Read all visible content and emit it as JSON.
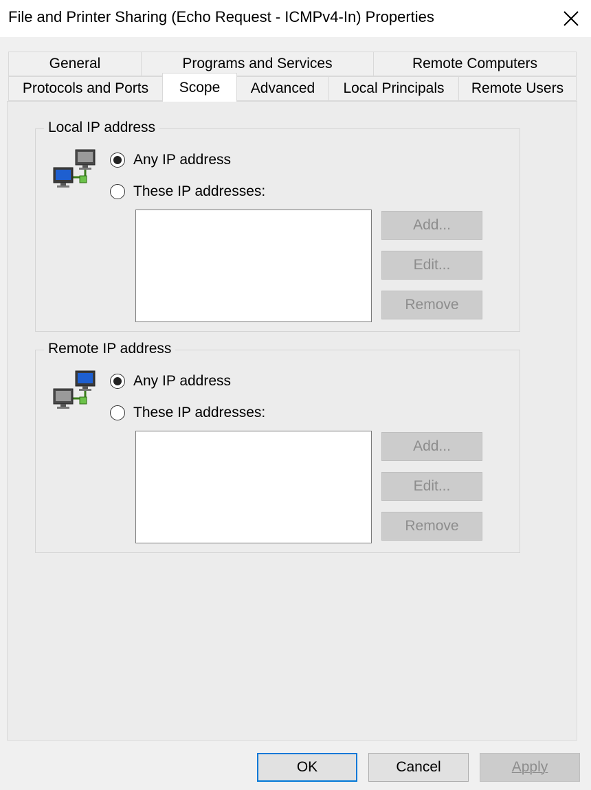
{
  "window": {
    "title": "File and Printer Sharing (Echo Request - ICMPv4-In) Properties",
    "close_icon": "close-icon"
  },
  "tabs": {
    "row1": [
      "General",
      "Programs and Services",
      "Remote Computers"
    ],
    "row2": [
      "Protocols and Ports",
      "Scope",
      "Advanced",
      "Local Principals",
      "Remote Users"
    ],
    "active": "Scope"
  },
  "local": {
    "group_label": "Local IP address",
    "icon": "network-computers-icon",
    "any_label": "Any IP address",
    "these_label": "These IP addresses:",
    "selected": "any",
    "add": "Add...",
    "edit": "Edit...",
    "remove": "Remove"
  },
  "remote": {
    "group_label": "Remote IP address",
    "icon": "network-computers-icon",
    "any_label": "Any IP address",
    "these_label": "These IP addresses:",
    "selected": "any",
    "add": "Add...",
    "edit": "Edit...",
    "remove": "Remove"
  },
  "buttons": {
    "ok": "OK",
    "cancel": "Cancel",
    "apply": "Apply"
  },
  "colors": {
    "accent": "#0078d7",
    "window_bg": "#f0f0f0",
    "disabled_button": "#cccccc"
  }
}
